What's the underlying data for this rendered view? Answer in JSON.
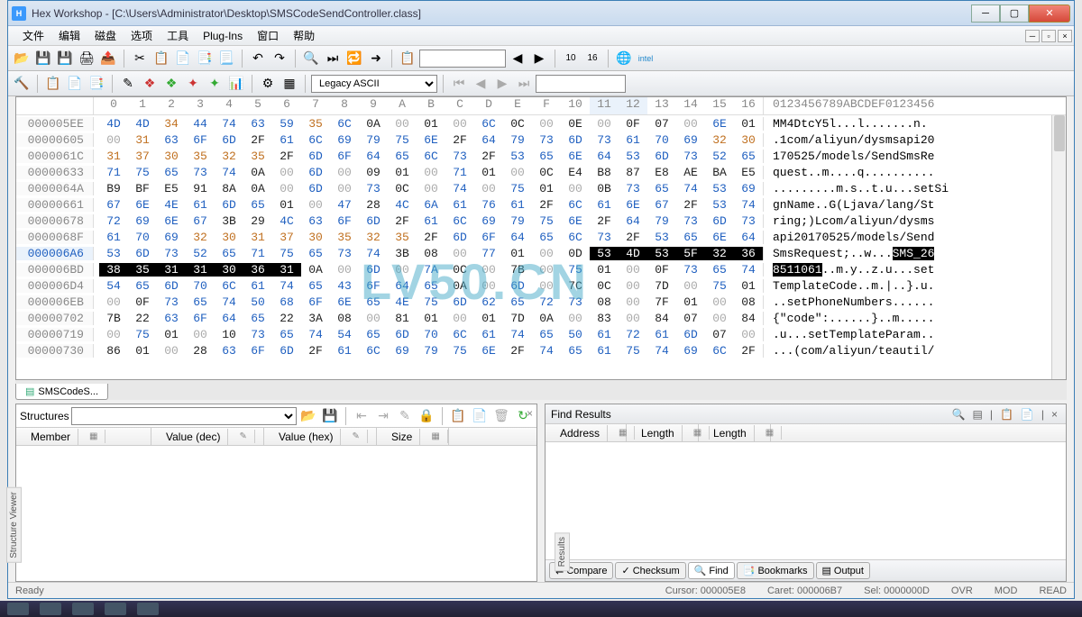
{
  "title": "Hex Workshop - [C:\\Users\\Administrator\\Desktop\\SMSCodeSendController.class]",
  "app_icon_letter": "H",
  "menu": [
    "文件",
    "编辑",
    "磁盘",
    "选项",
    "工具",
    "Plug-Ins",
    "窗口",
    "帮助"
  ],
  "encoding": "Legacy ASCII",
  "hex_cols": [
    "0",
    "1",
    "2",
    "3",
    "4",
    "5",
    "6",
    "7",
    "8",
    "9",
    "A",
    "B",
    "C",
    "D",
    "E",
    "F",
    "10",
    "11",
    "12",
    "13",
    "14",
    "15",
    "16"
  ],
  "ascii_header": "0123456789ABCDEF0123456",
  "highlight_col_indexes": [
    17,
    18
  ],
  "highlight_row": "000006A6",
  "rows": [
    {
      "off": "000005EE",
      "hex": [
        "4D",
        "4D",
        "34",
        "44",
        "74",
        "63",
        "59",
        "35",
        "6C",
        "0A",
        "00",
        "01",
        "00",
        "6C",
        "0C",
        "00",
        "0E",
        "00",
        "0F",
        "07",
        "00",
        "6E",
        "01"
      ],
      "ascii": "MM4DtcY5l...l.......n."
    },
    {
      "off": "00000605",
      "hex": [
        "00",
        "31",
        "63",
        "6F",
        "6D",
        "2F",
        "61",
        "6C",
        "69",
        "79",
        "75",
        "6E",
        "2F",
        "64",
        "79",
        "73",
        "6D",
        "73",
        "61",
        "70",
        "69",
        "32",
        "30"
      ],
      "ascii": ".1com/aliyun/dysmsapi20"
    },
    {
      "off": "0000061C",
      "hex": [
        "31",
        "37",
        "30",
        "35",
        "32",
        "35",
        "2F",
        "6D",
        "6F",
        "64",
        "65",
        "6C",
        "73",
        "2F",
        "53",
        "65",
        "6E",
        "64",
        "53",
        "6D",
        "73",
        "52",
        "65"
      ],
      "ascii": "170525/models/SendSmsRe"
    },
    {
      "off": "00000633",
      "hex": [
        "71",
        "75",
        "65",
        "73",
        "74",
        "0A",
        "00",
        "6D",
        "00",
        "09",
        "01",
        "00",
        "71",
        "01",
        "00",
        "0C",
        "E4",
        "B8",
        "87",
        "E8",
        "AE",
        "BA",
        "E5"
      ],
      "ascii": "quest..m....q.........."
    },
    {
      "off": "0000064A",
      "hex": [
        "B9",
        "BF",
        "E5",
        "91",
        "8A",
        "0A",
        "00",
        "6D",
        "00",
        "73",
        "0C",
        "00",
        "74",
        "00",
        "75",
        "01",
        "00",
        "0B",
        "73",
        "65",
        "74",
        "53",
        "69"
      ],
      "ascii": ".........m.s..t.u...setSi"
    },
    {
      "off": "00000661",
      "hex": [
        "67",
        "6E",
        "4E",
        "61",
        "6D",
        "65",
        "01",
        "00",
        "47",
        "28",
        "4C",
        "6A",
        "61",
        "76",
        "61",
        "2F",
        "6C",
        "61",
        "6E",
        "67",
        "2F",
        "53",
        "74"
      ],
      "ascii": "gnName..G(Ljava/lang/St"
    },
    {
      "off": "00000678",
      "hex": [
        "72",
        "69",
        "6E",
        "67",
        "3B",
        "29",
        "4C",
        "63",
        "6F",
        "6D",
        "2F",
        "61",
        "6C",
        "69",
        "79",
        "75",
        "6E",
        "2F",
        "64",
        "79",
        "73",
        "6D",
        "73"
      ],
      "ascii": "ring;)Lcom/aliyun/dysms"
    },
    {
      "off": "0000068F",
      "hex": [
        "61",
        "70",
        "69",
        "32",
        "30",
        "31",
        "37",
        "30",
        "35",
        "32",
        "35",
        "2F",
        "6D",
        "6F",
        "64",
        "65",
        "6C",
        "73",
        "2F",
        "53",
        "65",
        "6E",
        "64"
      ],
      "ascii": "api20170525/models/Send"
    },
    {
      "off": "000006A6",
      "hex": [
        "53",
        "6D",
        "73",
        "52",
        "65",
        "71",
        "75",
        "65",
        "73",
        "74",
        "3B",
        "08",
        "00",
        "77",
        "01",
        "00",
        "0D",
        "53",
        "4D",
        "53",
        "5F",
        "32",
        "36"
      ],
      "ascii": "SmsRequest;..w...",
      "ascii_sel": "SMS_26",
      "sel_hex": [
        17,
        18,
        19,
        20,
        21,
        22
      ]
    },
    {
      "off": "000006BD",
      "hex": [
        "38",
        "35",
        "31",
        "31",
        "30",
        "36",
        "31",
        "0A",
        "00",
        "6D",
        "00",
        "7A",
        "0C",
        "00",
        "7B",
        "00",
        "75",
        "01",
        "00",
        "0F",
        "73",
        "65",
        "74"
      ],
      "ascii_sel_start": "8511061",
      "ascii": "..m.y..z.u...set",
      "sel_hex": [
        0,
        1,
        2,
        3,
        4,
        5,
        6
      ]
    },
    {
      "off": "000006D4",
      "hex": [
        "54",
        "65",
        "6D",
        "70",
        "6C",
        "61",
        "74",
        "65",
        "43",
        "6F",
        "64",
        "65",
        "0A",
        "00",
        "6D",
        "00",
        "7C",
        "0C",
        "00",
        "7D",
        "00",
        "75",
        "01"
      ],
      "ascii": "TemplateCode..m.|..}.u."
    },
    {
      "off": "000006EB",
      "hex": [
        "00",
        "0F",
        "73",
        "65",
        "74",
        "50",
        "68",
        "6F",
        "6E",
        "65",
        "4E",
        "75",
        "6D",
        "62",
        "65",
        "72",
        "73",
        "08",
        "00",
        "7F",
        "01",
        "00",
        "08"
      ],
      "ascii": "..setPhoneNumbers......"
    },
    {
      "off": "00000702",
      "hex": [
        "7B",
        "22",
        "63",
        "6F",
        "64",
        "65",
        "22",
        "3A",
        "08",
        "00",
        "81",
        "01",
        "00",
        "01",
        "7D",
        "0A",
        "00",
        "83",
        "00",
        "84",
        "07",
        "00",
        "84"
      ],
      "ascii": "{\"code\":......}..m....."
    },
    {
      "off": "00000719",
      "hex": [
        "00",
        "75",
        "01",
        "00",
        "10",
        "73",
        "65",
        "74",
        "54",
        "65",
        "6D",
        "70",
        "6C",
        "61",
        "74",
        "65",
        "50",
        "61",
        "72",
        "61",
        "6D",
        "07",
        "00"
      ],
      "ascii": ".u...setTemplateParam.."
    },
    {
      "off": "00000730",
      "hex": [
        "86",
        "01",
        "00",
        "28",
        "63",
        "6F",
        "6D",
        "2F",
        "61",
        "6C",
        "69",
        "79",
        "75",
        "6E",
        "2F",
        "74",
        "65",
        "61",
        "75",
        "74",
        "69",
        "6C",
        "2F"
      ],
      "ascii": "...(com/aliyun/teautil/"
    }
  ],
  "file_tab": "SMSCodeS...",
  "structures_title": "Structures",
  "structures_cols": [
    "Member",
    "Value (dec)",
    "Value (hex)",
    "Size"
  ],
  "find_title": "Find Results",
  "find_cols": [
    "Address",
    "Length",
    "Length"
  ],
  "result_tabs": [
    {
      "icon": "⇄",
      "label": "Compare"
    },
    {
      "icon": "✓",
      "label": "Checksum"
    },
    {
      "icon": "🔍",
      "label": "Find",
      "active": true
    },
    {
      "icon": "📑",
      "label": "Bookmarks"
    },
    {
      "icon": "▤",
      "label": "Output"
    }
  ],
  "status": {
    "left": "Ready",
    "cursor": "Cursor: 000005E8",
    "caret": "Caret: 000006B7",
    "sel": "Sel: 0000000D",
    "ovr": "OVR",
    "mod": "MOD",
    "read": "READ"
  },
  "sidebar_left": "Structure Viewer",
  "sidebar_right": "Results",
  "watermark": "LV50.CN"
}
